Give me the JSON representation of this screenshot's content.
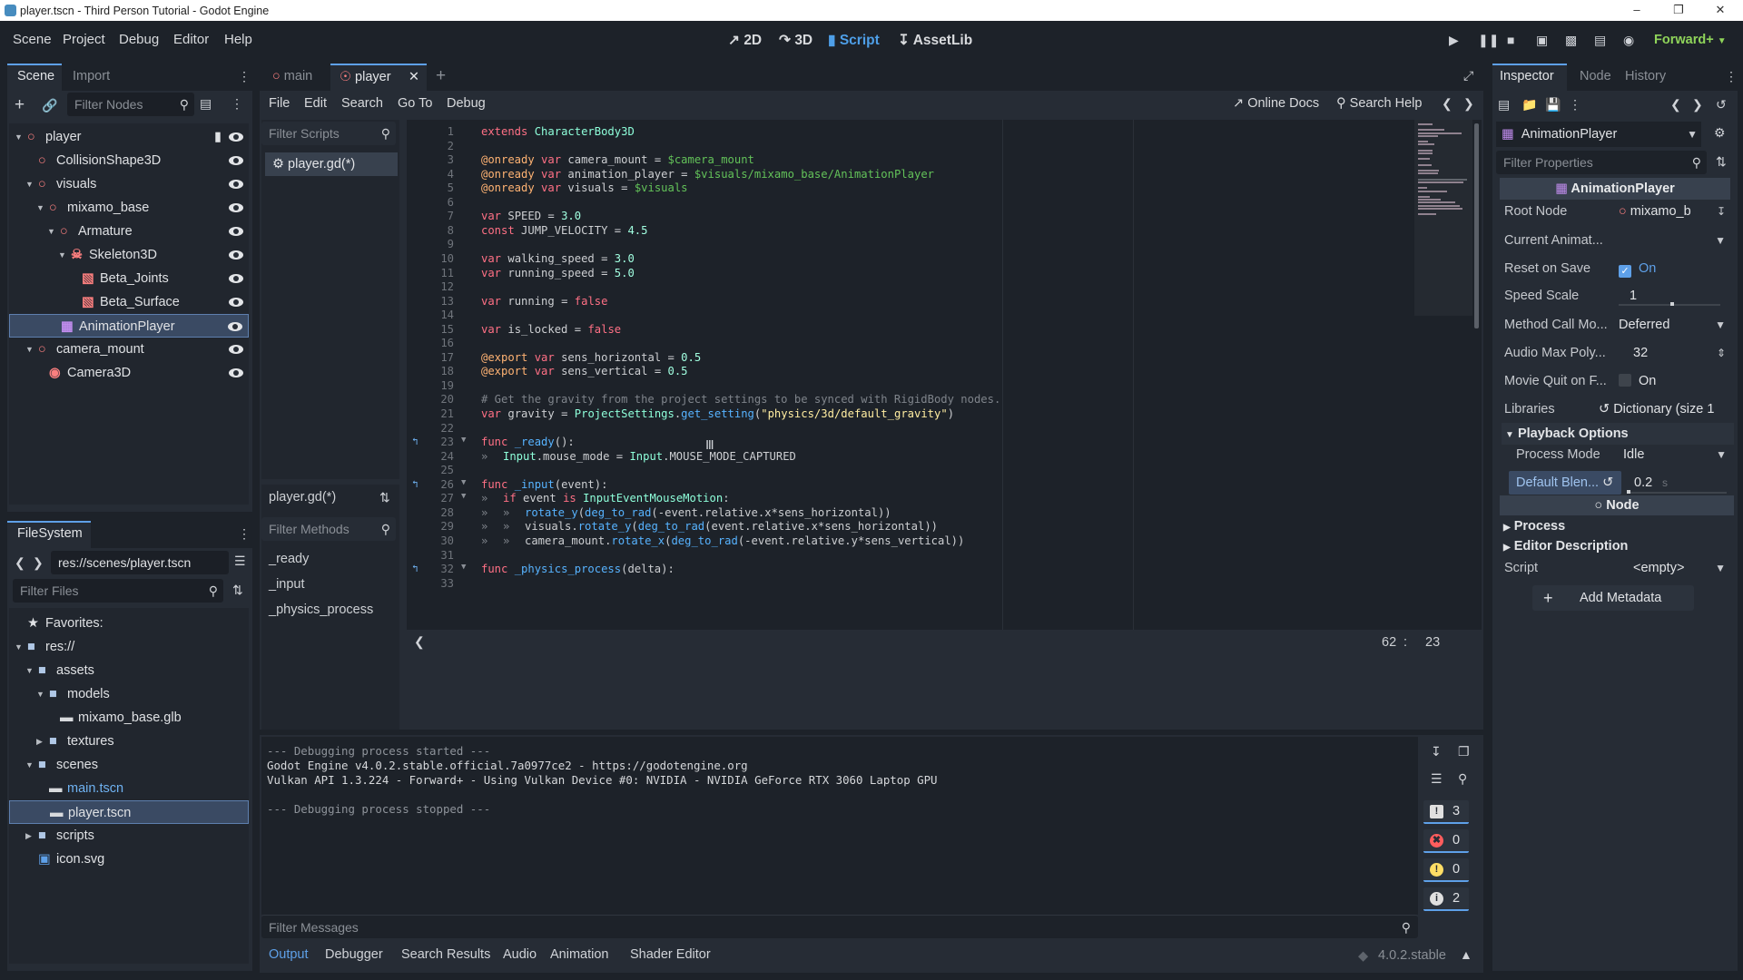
{
  "window": {
    "title": "player.tscn - Third Person Tutorial - Godot Engine"
  },
  "menubar": {
    "items": [
      "Scene",
      "Project",
      "Debug",
      "Editor",
      "Help"
    ]
  },
  "workspaces": [
    {
      "label": "2D",
      "icon": "2d-icon"
    },
    {
      "label": "3D",
      "icon": "3d-icon"
    },
    {
      "label": "Script",
      "icon": "script-icon",
      "active": true
    },
    {
      "label": "AssetLib",
      "icon": "assetlib-icon"
    }
  ],
  "renderer": "Forward+",
  "scene_dock": {
    "tabs": [
      "Scene",
      "Import"
    ],
    "filter_placeholder": "Filter Nodes",
    "nodes": [
      {
        "label": "player",
        "depth": 0,
        "icon": "node3d-icon",
        "color": "#fc7f7f",
        "script": true
      },
      {
        "label": "CollisionShape3D",
        "depth": 1,
        "icon": "node3d-icon",
        "color": "#fc7f7f"
      },
      {
        "label": "visuals",
        "depth": 1,
        "icon": "node3d-icon",
        "color": "#fc7f7f"
      },
      {
        "label": "mixamo_base",
        "depth": 2,
        "icon": "node3d-icon",
        "color": "#fc7f7f"
      },
      {
        "label": "Armature",
        "depth": 3,
        "icon": "node3d-icon",
        "color": "#fc7f7f"
      },
      {
        "label": "Skeleton3D",
        "depth": 4,
        "icon": "skeleton-icon",
        "color": "#fc7f7f"
      },
      {
        "label": "Beta_Joints",
        "depth": 5,
        "icon": "mesh-icon",
        "color": "#fc7f7f"
      },
      {
        "label": "Beta_Surface",
        "depth": 5,
        "icon": "mesh-icon",
        "color": "#fc7f7f"
      },
      {
        "label": "AnimationPlayer",
        "depth": 3,
        "icon": "animation-icon",
        "color": "#c38ef1",
        "selected": true
      },
      {
        "label": "camera_mount",
        "depth": 1,
        "icon": "node3d-icon",
        "color": "#fc7f7f"
      },
      {
        "label": "Camera3D",
        "depth": 2,
        "icon": "camera-icon",
        "color": "#fc7f7f"
      }
    ]
  },
  "filesystem": {
    "title": "FileSystem",
    "path": "res://scenes/player.tscn",
    "filter_placeholder": "Filter Files",
    "items": [
      {
        "label": "Favorites:",
        "depth": 0,
        "icon": "star-icon"
      },
      {
        "label": "res://",
        "depth": 0,
        "icon": "folder-icon"
      },
      {
        "label": "assets",
        "depth": 1,
        "icon": "folder-icon"
      },
      {
        "label": "models",
        "depth": 2,
        "icon": "folder-icon"
      },
      {
        "label": "mixamo_base.glb",
        "depth": 3,
        "icon": "scene-file-icon"
      },
      {
        "label": "textures",
        "depth": 2,
        "icon": "folder-icon"
      },
      {
        "label": "scenes",
        "depth": 1,
        "icon": "folder-icon"
      },
      {
        "label": "main.tscn",
        "depth": 2,
        "icon": "scene-file-icon",
        "highlight": true
      },
      {
        "label": "player.tscn",
        "depth": 2,
        "icon": "scene-file-icon",
        "selected": true
      },
      {
        "label": "scripts",
        "depth": 1,
        "icon": "folder-icon"
      },
      {
        "label": "icon.svg",
        "depth": 1,
        "icon": "image-file-icon"
      }
    ]
  },
  "editor_tabs": [
    {
      "label": "main"
    },
    {
      "label": "player",
      "active": true
    }
  ],
  "script_menu": [
    "File",
    "Edit",
    "Search",
    "Go To",
    "Debug"
  ],
  "online_docs": "Online Docs",
  "search_help": "Search Help",
  "scripts_panel": {
    "filter_placeholder": "Filter Scripts",
    "items": [
      "player.gd(*)"
    ],
    "current": "player.gd(*)",
    "methods_placeholder": "Filter Methods",
    "methods": [
      "_ready",
      "_input",
      "_physics_process"
    ]
  },
  "code": [
    "extends CharacterBody3D",
    "",
    "@onready var camera_mount = $camera_mount",
    "@onready var animation_player = $visuals/mixamo_base/AnimationPlayer",
    "@onready var visuals = $visuals",
    "",
    "var SPEED = 3.0",
    "const JUMP_VELOCITY = 4.5",
    "",
    "var walking_speed = 3.0",
    "var running_speed = 5.0",
    "",
    "var running = false",
    "",
    "var is_locked = false",
    "",
    "@export var sens_horizontal = 0.5",
    "@export var sens_vertical = 0.5",
    "",
    "# Get the gravity from the project settings to be synced with RigidBody nodes.",
    "var gravity = ProjectSettings.get_setting(\"physics/3d/default_gravity\")",
    "",
    "func _ready():",
    "\tInput.mouse_mode = Input.MOUSE_MODE_CAPTURED",
    "",
    "func _input(event):",
    "\tif event is InputEventMouseMotion:",
    "\t\trotate_y(deg_to_rad(-event.relative.x*sens_horizontal))",
    "\t\tvisuals.rotate_y(deg_to_rad(event.relative.x*sens_horizontal))",
    "\t\tcamera_mount.rotate_x(deg_to_rad(-event.relative.y*sens_vertical))",
    "",
    "func _physics_process(delta):",
    ""
  ],
  "cursor_pos": {
    "line": "62",
    "sep": ":",
    "col": "23"
  },
  "output": {
    "lines": [
      "--- Debugging process started ---",
      "Godot Engine v4.0.2.stable.official.7a0977ce2 - https://godotengine.org",
      "Vulkan API 1.3.224 - Forward+ - Using Vulkan Device #0: NVIDIA - NVIDIA GeForce RTX 3060 Laptop GPU",
      "",
      "--- Debugging process stopped ---"
    ],
    "filter_placeholder": "Filter Messages",
    "counts": [
      {
        "icon": "message-icon",
        "value": "3",
        "color": "#e0e0e0"
      },
      {
        "icon": "error-icon",
        "value": "0",
        "color": "#ff5d5d"
      },
      {
        "icon": "warning-icon",
        "value": "0",
        "color": "#ffdd65"
      },
      {
        "icon": "info-icon",
        "value": "2",
        "color": "#e0e0e0"
      }
    ]
  },
  "bottom_tabs": [
    {
      "label": "Output",
      "active": true
    },
    {
      "label": "Debugger"
    },
    {
      "label": "Search Results"
    },
    {
      "label": "Audio"
    },
    {
      "label": "Animation"
    },
    {
      "label": "Shader Editor"
    }
  ],
  "version": "4.0.2.stable",
  "inspector": {
    "tabs": [
      "Inspector",
      "Node",
      "History"
    ],
    "object": "AnimationPlayer",
    "filter_placeholder": "Filter Properties",
    "class_header": "AnimationPlayer",
    "props": [
      {
        "label": "Root Node",
        "value": "mixamo_b"
      },
      {
        "label": "Current Animat...",
        "value": ""
      },
      {
        "label": "Reset on Save",
        "value": "On",
        "checkbox": true,
        "checked": true
      },
      {
        "label": "Speed Scale",
        "value": "1",
        "slider": true
      },
      {
        "label": "Method Call Mo...",
        "value": "Deferred",
        "dropdown": true
      },
      {
        "label": "Audio Max Poly...",
        "value": "32",
        "spin": true
      },
      {
        "label": "Movie Quit on F...",
        "value": "On",
        "checkbox": true,
        "checked": false
      },
      {
        "label": "Libraries",
        "value": "Dictionary (size 1"
      }
    ],
    "playback_options": "Playback Options",
    "process_mode": {
      "label": "Process Mode",
      "value": "Idle"
    },
    "default_blend": {
      "label": "Default Blen...",
      "value": "0.2",
      "unit": "s"
    },
    "node_header": "Node",
    "sections": [
      "Process",
      "Editor Description"
    ],
    "script": {
      "label": "Script",
      "value": "<empty>"
    },
    "add_metadata": "Add Metadata"
  }
}
